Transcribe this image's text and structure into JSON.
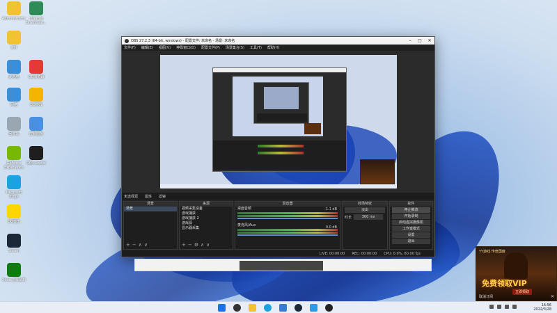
{
  "desktop_icons": [
    {
      "label": "Administrator",
      "color": "#f1c232"
    },
    {
      "label": "Internet Download...",
      "color": "#2e8b57"
    },
    {
      "label": "文件",
      "color": "#f1c232"
    },
    {
      "label": "此电脑",
      "color": "#3b8fd9"
    },
    {
      "label": "QQ浏览器",
      "color": "#e53935"
    },
    {
      "label": "网络",
      "color": "#3b8fd9"
    },
    {
      "label": "QQ游戏",
      "color": "#f5b400"
    },
    {
      "label": "回收站",
      "color": "#9aa6b2"
    },
    {
      "label": "控制面板",
      "color": "#4a90e2"
    },
    {
      "label": "GeForce Experience",
      "color": "#76b900"
    },
    {
      "label": "OBS Studio",
      "color": "#1e1e1e"
    },
    {
      "label": "Microsoft Edge",
      "color": "#1ba2e0"
    },
    {
      "label": "QQ音乐",
      "color": "#ffd600"
    },
    {
      "label": "Steam",
      "color": "#1b2838"
    },
    {
      "label": "Xbox 游戏录制",
      "color": "#107c10"
    }
  ],
  "obs": {
    "title": "OBS 27.2.3 (64-bit, windows) - 配置文件: 未命名 - 场景: 未命名",
    "menu": [
      "文件(F)",
      "编辑(E)",
      "视图(V)",
      "停靠窗口(D)",
      "配置文件(P)",
      "场景集合(S)",
      "工具(T)",
      "帮助(H)"
    ],
    "source_toolbar": [
      "未选择源",
      "属性",
      "滤镜"
    ],
    "panels": {
      "scenes": {
        "title": "场景",
        "items": [
          "场景"
        ]
      },
      "sources": {
        "title": "来源",
        "items": [
          "视频采集设备",
          "游戏捕获",
          "游戏捕获 2",
          "游戏源",
          "显示器采集"
        ]
      },
      "mixer": {
        "title": "混音器",
        "channels": [
          {
            "name": "桌面音频",
            "level": "-1.1 dB"
          },
          {
            "name": "麦克风/Aux",
            "level": "0.0 dB"
          }
        ]
      },
      "transitions": {
        "title": "转场特效",
        "type": "淡出",
        "duration_label": "时长",
        "duration": "300 ms"
      },
      "controls": {
        "title": "控件",
        "buttons": [
          "停止推流",
          "开始录制",
          "启动虚拟摄像机",
          "工作室模式",
          "设置",
          "退出"
        ]
      }
    },
    "status": [
      "LIVE: 00:00:00",
      "REC: 00:00:00",
      "CPU: 0.9%, 60.00 fps"
    ]
  },
  "ad": {
    "title": "YY游戏 传奇国度",
    "headline": "免费领取VIP",
    "button": "立即领取",
    "close_label": "取消订阅"
  },
  "taskbar": {
    "time": "16:56",
    "date": "2022/3/28",
    "pinned": [
      "windows-start",
      "search",
      "file-explorer",
      "edge",
      "store",
      "steam",
      "qq",
      "obs",
      "obs-2"
    ]
  }
}
